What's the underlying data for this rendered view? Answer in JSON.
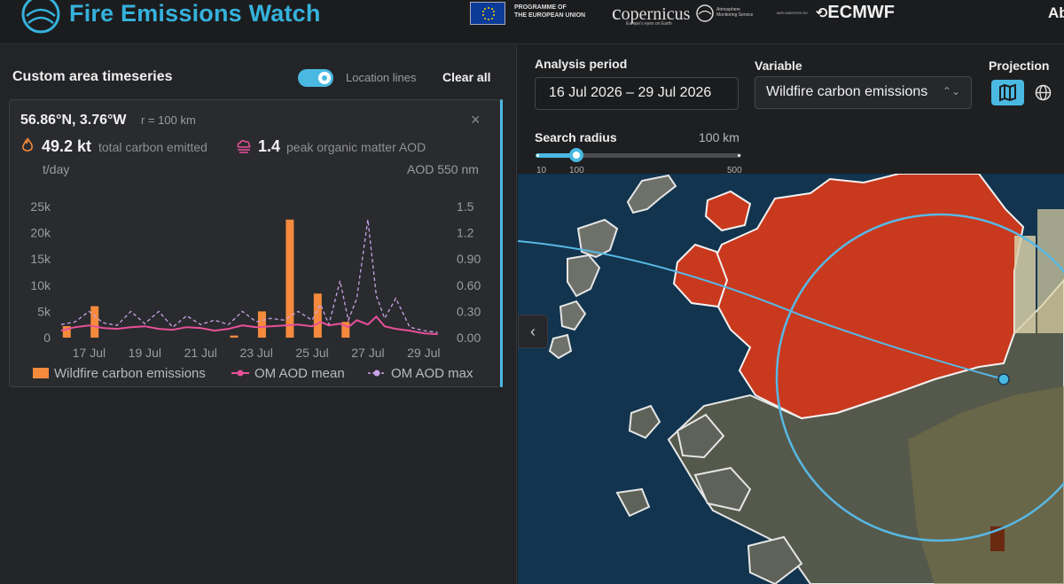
{
  "header": {
    "title": "Fire Emissions Watch",
    "eu_text_line1": "PROGRAMME OF",
    "eu_text_line2": "THE EUROPEAN UNION",
    "copernicus": "opernicus",
    "copernicus_sub": "Europe's eyes on Earth",
    "cams_line1": "Atmosphere",
    "cams_line2": "Monitoring Service",
    "implemented_by": "IMPLEMENTED BY",
    "ecmwf": "ECMWF",
    "about": "Ab"
  },
  "sidebar": {
    "title": "Custom area timeseries",
    "toggle_label": "Location lines",
    "toggle_on": true,
    "clear_all": "Clear all"
  },
  "card": {
    "coords": "56.86°N, 3.76°W",
    "radius": "r = 100 km",
    "close": "×",
    "stat1_value": "49.2 kt",
    "stat1_label": "total carbon emitted",
    "stat2_value": "1.4",
    "stat2_label": "peak organic matter AOD",
    "unit_left": "t/day",
    "unit_right": "AOD 550 nm"
  },
  "chart_data": {
    "type": "bar",
    "left_axis": {
      "unit": "t/day",
      "ylim": [
        0,
        25000
      ],
      "ticks": [
        "0",
        "5k",
        "10k",
        "15k",
        "20k",
        "25k"
      ]
    },
    "right_axis": {
      "unit": "AOD 550 nm",
      "ylim": [
        0,
        1.5
      ],
      "ticks": [
        "0.00",
        "0.30",
        "0.60",
        "0.90",
        "1.2",
        "1.5"
      ]
    },
    "x_ticks": [
      "17 Jul",
      "19 Jul",
      "21 Jul",
      "23 Jul",
      "25 Jul",
      "27 Jul",
      "29 Jul"
    ],
    "x_range": [
      "16 Jul",
      "29 Jul"
    ],
    "series": [
      {
        "name": "Wildfire carbon emissions",
        "kind": "bar",
        "color": "#f58a3c",
        "dates": [
          "16 Jul",
          "17 Jul",
          "18 Jul",
          "19 Jul",
          "20 Jul",
          "21 Jul",
          "22 Jul",
          "23 Jul",
          "24 Jul",
          "25 Jul",
          "26 Jul",
          "27 Jul",
          "28 Jul",
          "29 Jul"
        ],
        "values": [
          2200,
          6000,
          0,
          0,
          0,
          0,
          400,
          5000,
          22500,
          8400,
          3000,
          0,
          0,
          0
        ]
      },
      {
        "name": "OM AOD mean",
        "kind": "line",
        "color": "#e8509a",
        "x": [
          16.0,
          16.5,
          17.0,
          17.5,
          18.0,
          18.5,
          19.0,
          19.5,
          20.0,
          20.5,
          21.0,
          21.5,
          22.0,
          22.5,
          23.0,
          23.5,
          24.0,
          24.5,
          25.0,
          25.3,
          25.6,
          26.0,
          26.3,
          26.6,
          27.0,
          27.3,
          27.6,
          28.0,
          28.5,
          29.0,
          29.5
        ],
        "values": [
          0.08,
          0.12,
          0.14,
          0.11,
          0.1,
          0.12,
          0.13,
          0.1,
          0.09,
          0.12,
          0.11,
          0.08,
          0.1,
          0.14,
          0.12,
          0.13,
          0.14,
          0.15,
          0.13,
          0.18,
          0.14,
          0.16,
          0.12,
          0.2,
          0.15,
          0.24,
          0.13,
          0.1,
          0.08,
          0.05,
          0.04
        ]
      },
      {
        "name": "OM AOD max",
        "kind": "dashed",
        "color": "#c9a3e6",
        "x": [
          16.0,
          16.5,
          17.0,
          17.5,
          18.0,
          18.5,
          19.0,
          19.5,
          20.0,
          20.5,
          21.0,
          21.5,
          22.0,
          22.5,
          23.0,
          23.5,
          24.0,
          24.5,
          25.0,
          25.3,
          25.6,
          26.0,
          26.3,
          26.6,
          27.0,
          27.3,
          27.6,
          28.0,
          28.5,
          29.0,
          29.5
        ],
        "values": [
          0.15,
          0.18,
          0.3,
          0.17,
          0.14,
          0.3,
          0.16,
          0.3,
          0.12,
          0.25,
          0.15,
          0.2,
          0.15,
          0.3,
          0.18,
          0.22,
          0.2,
          0.3,
          0.2,
          0.38,
          0.15,
          0.65,
          0.2,
          0.45,
          1.35,
          0.48,
          0.22,
          0.45,
          0.12,
          0.08,
          0.06
        ]
      }
    ],
    "legend": [
      "Wildfire carbon emissions",
      "OM AOD mean",
      "OM AOD max"
    ],
    "legend_position": "bottom"
  },
  "controls": {
    "period_label": "Analysis period",
    "period_value": "16 Jul 2026 – 29 Jul 2026",
    "variable_label": "Variable",
    "variable_value": "Wildfire carbon emissions",
    "projection_label": "Projection",
    "search_radius_label": "Search radius",
    "search_radius_value": "100 km",
    "slider_value_km": 100,
    "slider_ticks": [
      "10",
      "100",
      "500"
    ]
  },
  "map": {
    "collapse": "‹",
    "accent_color": "#4ab9e2",
    "fire_color": "#c9391e"
  }
}
